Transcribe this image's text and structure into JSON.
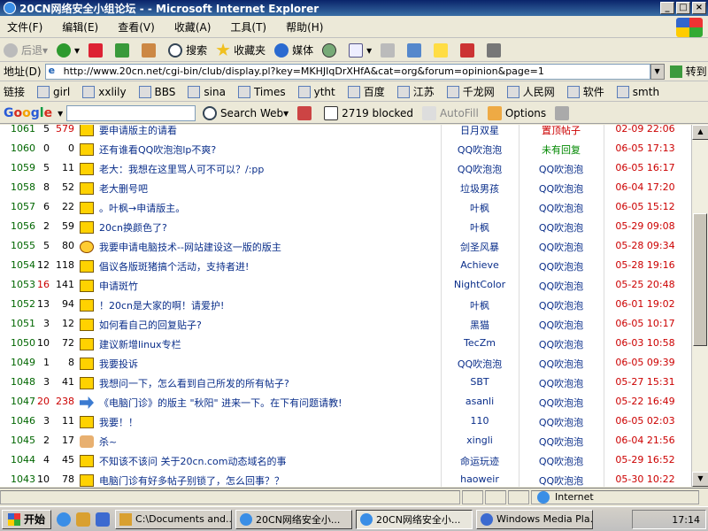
{
  "window": {
    "title": "20CN网络安全小组论坛 - - Microsoft Internet Explorer"
  },
  "menu": [
    "文件(F)",
    "编辑(E)",
    "查看(V)",
    "收藏(A)",
    "工具(T)",
    "帮助(H)"
  ],
  "toolbar": {
    "back": "后退",
    "search": "搜索",
    "favorites": "收藏夹",
    "media": "媒体"
  },
  "address": {
    "label": "地址(D)",
    "url": "http://www.20cn.net/cgi-bin/club/display.pl?key=MKHJIqDrXHfA&cat=org&forum=opinion&page=1",
    "go": "转到"
  },
  "links": {
    "label": "链接",
    "items": [
      "girl",
      "xxlily",
      "BBS",
      "sina",
      "Times",
      "ytht",
      "百度",
      "江苏",
      "千龙网",
      "人民网",
      "软件",
      "smth"
    ]
  },
  "google": {
    "search_web": "Search Web",
    "blocked": "2719 blocked",
    "autofill": "AutoFill",
    "options": "Options"
  },
  "threads": [
    {
      "id": "1061",
      "replies": "5",
      "views": "579",
      "icon": "folder",
      "title": "要申请版主的请看",
      "author": "日月双星",
      "last": "置顶帖子",
      "date": "02-09 22:06"
    },
    {
      "id": "1060",
      "replies": "0",
      "views": "0",
      "icon": "folder",
      "title": "还有谁看QQ吹泡泡lp不爽?",
      "author": "QQ吹泡泡",
      "last": "未有回复",
      "date": "06-05 17:13"
    },
    {
      "id": "1059",
      "replies": "5",
      "views": "11",
      "icon": "folder",
      "title": "老大：我想在这里骂人可不可以？/:pp",
      "author": "QQ吹泡泡",
      "last": "QQ吹泡泡",
      "date": "06-05 16:17"
    },
    {
      "id": "1058",
      "replies": "8",
      "views": "52",
      "icon": "folder",
      "title": "老大删号吧",
      "author": "垃圾男孩",
      "last": "QQ吹泡泡",
      "date": "06-04 17:20"
    },
    {
      "id": "1057",
      "replies": "6",
      "views": "22",
      "icon": "folder",
      "title": "。叶枫→申请版主。",
      "author": "叶枫",
      "last": "QQ吹泡泡",
      "date": "06-05 15:12"
    },
    {
      "id": "1056",
      "replies": "2",
      "views": "59",
      "icon": "folder",
      "title": "20cn换颜色了?",
      "author": "叶枫",
      "last": "QQ吹泡泡",
      "date": "05-29 09:08"
    },
    {
      "id": "1055",
      "replies": "5",
      "views": "80",
      "icon": "smile",
      "title": "我要申请电脑技术--网站建设这一版的版主",
      "author": "剑圣风暴",
      "last": "QQ吹泡泡",
      "date": "05-28 09:34"
    },
    {
      "id": "1054",
      "replies": "12",
      "views": "118",
      "icon": "folder",
      "title": "倡议各版斑猪搞个活动，支持者进!",
      "author": "Achieve",
      "last": "QQ吹泡泡",
      "date": "05-28 19:16"
    },
    {
      "id": "1053",
      "replies": "16",
      "views": "141",
      "icon": "folder",
      "title": "申请斑竹",
      "author": "NightColor",
      "last": "QQ吹泡泡",
      "date": "05-25 20:48"
    },
    {
      "id": "1052",
      "replies": "13",
      "views": "94",
      "icon": "folder",
      "title": "！20cn是大家的啊！请爱护!",
      "author": "叶枫",
      "last": "QQ吹泡泡",
      "date": "06-01 19:02"
    },
    {
      "id": "1051",
      "replies": "3",
      "views": "12",
      "icon": "folder",
      "title": "如何看自己的回复贴子?",
      "author": "黑猫",
      "last": "QQ吹泡泡",
      "date": "06-05 10:17"
    },
    {
      "id": "1050",
      "replies": "10",
      "views": "72",
      "icon": "folder",
      "title": "建议新增linux专栏",
      "author": "TecZm",
      "last": "QQ吹泡泡",
      "date": "06-03 10:58"
    },
    {
      "id": "1049",
      "replies": "1",
      "views": "8",
      "icon": "folder",
      "title": "我要投诉",
      "author": "QQ吹泡泡",
      "last": "QQ吹泡泡",
      "date": "06-05 09:39"
    },
    {
      "id": "1048",
      "replies": "3",
      "views": "41",
      "icon": "folder",
      "title": "我想问一下，怎么看到自己所发的所有帖子?",
      "author": "SBT",
      "last": "QQ吹泡泡",
      "date": "05-27 15:31"
    },
    {
      "id": "1047",
      "replies": "20",
      "views": "238",
      "icon": "arrow",
      "title": "《电脑门诊》的版主 \"秋阳\" 进来一下。在下有问题请教!",
      "author": "asanli",
      "last": "QQ吹泡泡",
      "date": "05-22 16:49"
    },
    {
      "id": "1046",
      "replies": "3",
      "views": "11",
      "icon": "folder",
      "title": "我要！！",
      "author": "110",
      "last": "QQ吹泡泡",
      "date": "06-05 02:03"
    },
    {
      "id": "1045",
      "replies": "2",
      "views": "17",
      "icon": "hand",
      "title": "杀~",
      "author": "xingli",
      "last": "QQ吹泡泡",
      "date": "06-04 21:56"
    },
    {
      "id": "1044",
      "replies": "4",
      "views": "45",
      "icon": "folder",
      "title": "不知该不该问  关于20cn.com动态域名的事",
      "author": "命运玩迹",
      "last": "QQ吹泡泡",
      "date": "05-29 16:52"
    },
    {
      "id": "1043",
      "replies": "10",
      "views": "78",
      "icon": "folder",
      "title": "电脑门诊有好多帖子别锁了，怎么回事？？",
      "author": "haoweir",
      "last": "QQ吹泡泡",
      "date": "05-30 10:22"
    }
  ],
  "status": {
    "zone": "Internet"
  },
  "taskbar": {
    "start": "开始",
    "tasks": [
      "C:\\Documents and...",
      "20CN网络安全小...",
      "20CN网络安全小...",
      "Windows Media Pla..."
    ],
    "clock": "17:14"
  }
}
